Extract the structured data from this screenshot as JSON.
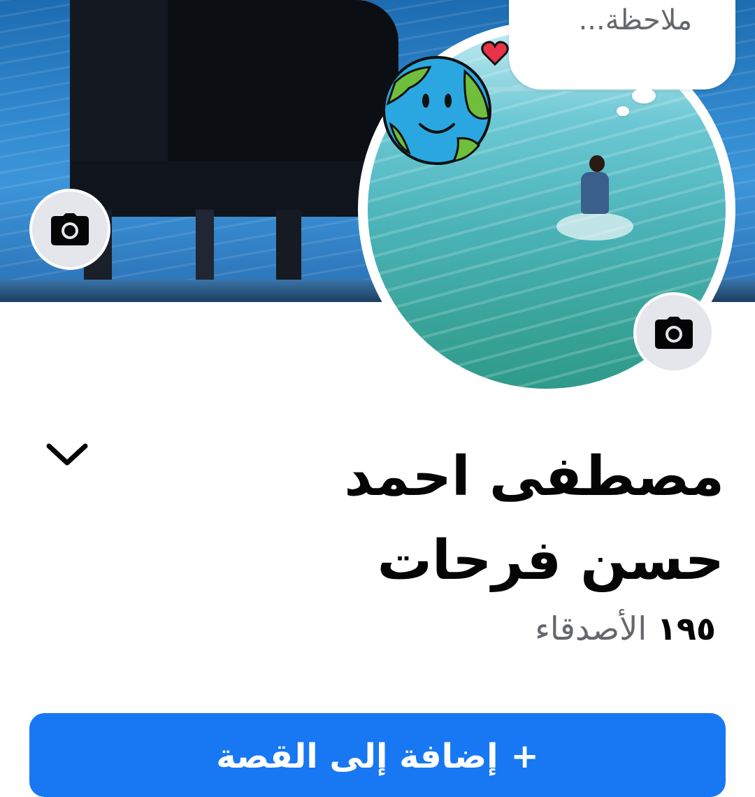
{
  "profile": {
    "name": "مصطفى احمد حسن فرحات",
    "friends_count": "١٩٥",
    "friends_label": "الأصدقاء"
  },
  "note": {
    "placeholder": "ملاحظة..."
  },
  "actions": {
    "add_story_label": "إضافة إلى القصة",
    "add_story_icon": "+"
  },
  "icons": {
    "cover_camera": "camera-icon",
    "avatar_camera": "camera-icon",
    "expand": "chevron-down-icon"
  },
  "colors": {
    "primary": "#1877f2",
    "secondary_text": "#65676b",
    "button_bg": "#e4e6eb"
  }
}
